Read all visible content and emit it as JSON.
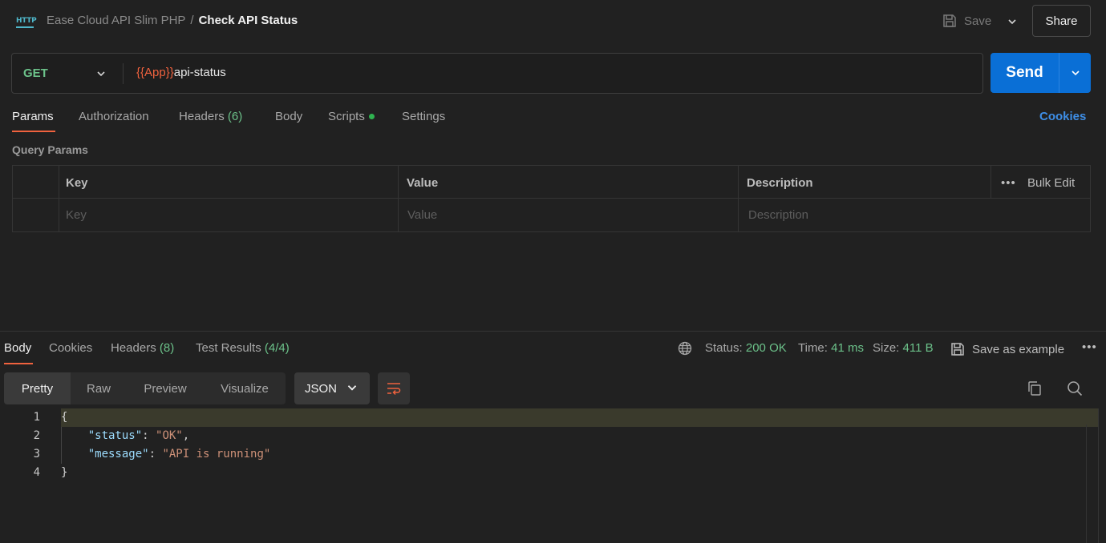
{
  "header": {
    "http_icon_label": "HTTP",
    "collection": "Ease Cloud API Slim PHP",
    "separator": "/",
    "request_name": "Check API Status",
    "save_label": "Save",
    "share_label": "Share"
  },
  "request": {
    "method": "GET",
    "url_variable": "{{App}}",
    "url_path": "api-status",
    "send_label": "Send"
  },
  "request_tabs": {
    "params": "Params",
    "authorization": "Authorization",
    "headers": "Headers",
    "headers_count": "(6)",
    "body": "Body",
    "scripts": "Scripts",
    "settings": "Settings",
    "cookies": "Cookies"
  },
  "query_params": {
    "title": "Query Params",
    "columns": {
      "key": "Key",
      "value": "Value",
      "description": "Description"
    },
    "bulk_edit": "Bulk Edit",
    "more": "•••",
    "placeholders": {
      "key": "Key",
      "value": "Value",
      "description": "Description"
    }
  },
  "response": {
    "tabs": {
      "body": "Body",
      "cookies": "Cookies",
      "headers": "Headers",
      "headers_count": "(8)",
      "tests": "Test Results",
      "tests_count": "(4/4)"
    },
    "status_label": "Status:",
    "status_value": "200 OK",
    "time_label": "Time:",
    "time_value": "41 ms",
    "size_label": "Size:",
    "size_value": "411 B",
    "save_example": "Save as example",
    "more": "•••",
    "views": {
      "pretty": "Pretty",
      "raw": "Raw",
      "preview": "Preview",
      "visualize": "Visualize"
    },
    "format": "JSON",
    "code": {
      "l1_no": "1",
      "l1": "{",
      "l2_no": "2",
      "l2_key": "\"status\"",
      "l2_colon": ": ",
      "l2_val": "\"OK\"",
      "l2_end": ",",
      "l3_no": "3",
      "l3_key": "\"message\"",
      "l3_colon": ": ",
      "l3_val": "\"API is running\"",
      "l4_no": "4",
      "l4": "}"
    }
  },
  "colors": {
    "accent_orange": "#f0623e",
    "send_blue": "#0a6fd6",
    "success_green": "#6cc28a",
    "background": "#212121"
  }
}
